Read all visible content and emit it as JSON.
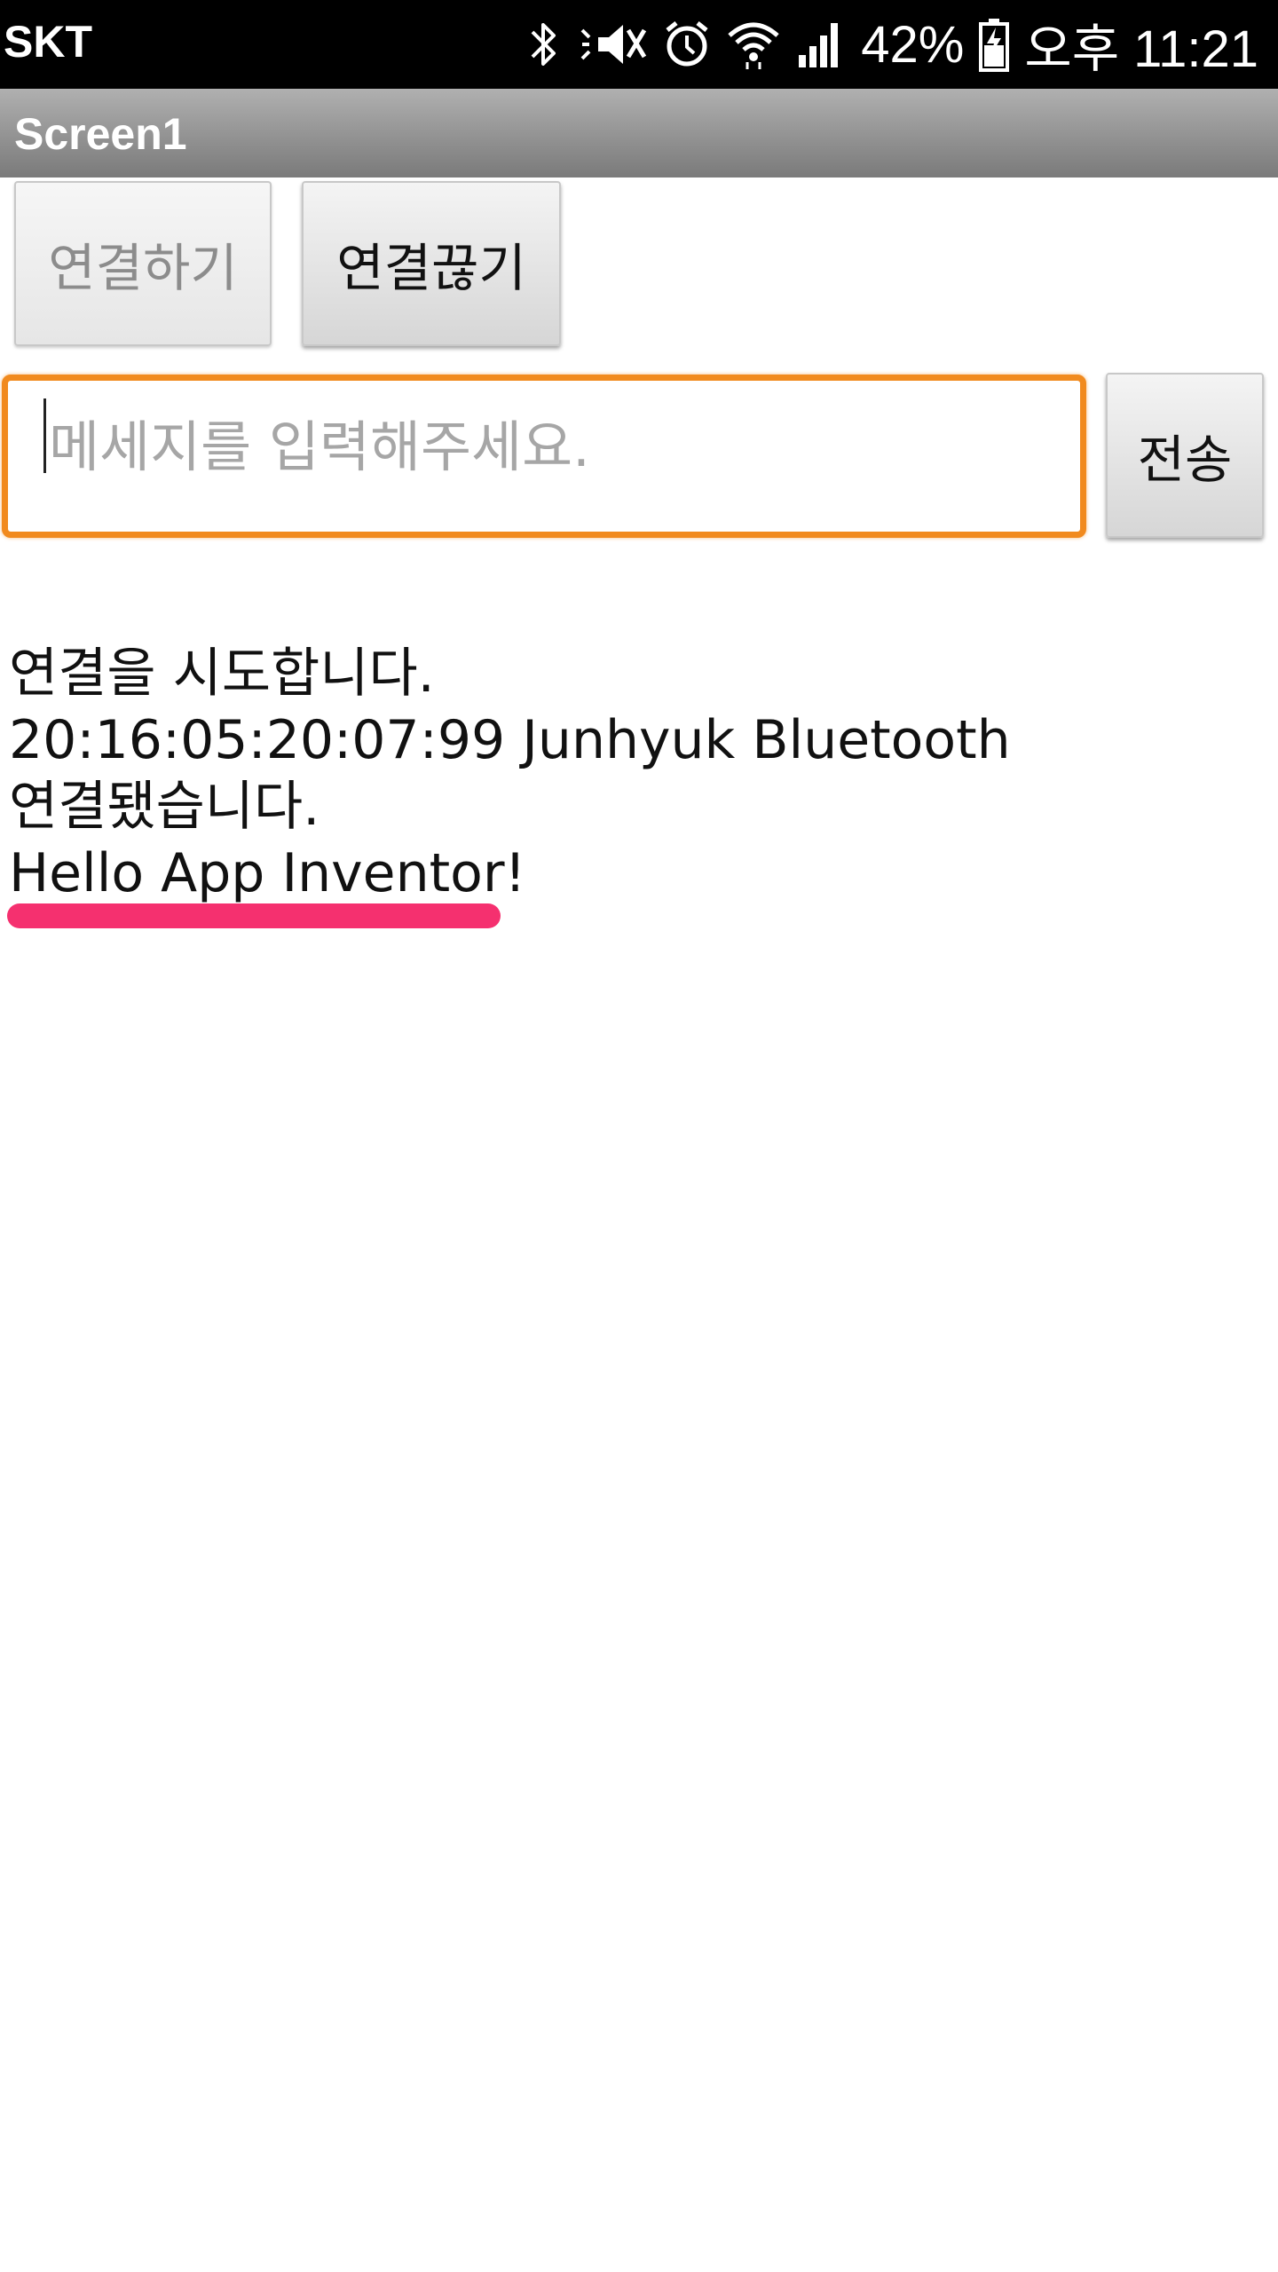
{
  "status_bar": {
    "carrier": "SKT",
    "battery_percent": "42%",
    "time": "오후 11:21",
    "icons": [
      "bluetooth-icon",
      "mute-icon",
      "alarm-icon",
      "wifi-icon",
      "signal-icon",
      "battery-icon"
    ]
  },
  "app": {
    "title": "Screen1"
  },
  "buttons": {
    "connect_label": "연결하기",
    "disconnect_label": "연결끊기",
    "send_label": "전송"
  },
  "message_input": {
    "placeholder": "메세지를 입력해주세요."
  },
  "log": [
    "연결을 시도합니다.",
    "20:16:05:20:07:99 Junhyuk Bluetooth",
    "연결됐습니다.",
    "Hello App Inventor!"
  ],
  "colors": {
    "input_border": "#f18a1e",
    "highlight": "#f5306f",
    "title_bar": "#8f8f8f"
  }
}
